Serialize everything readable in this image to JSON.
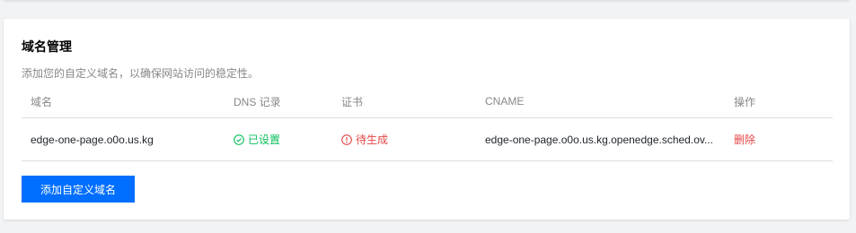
{
  "domain_management": {
    "title": "域名管理",
    "description": "添加您的自定义域名，以确保网站访问的稳定性。",
    "columns": {
      "domain": "域名",
      "dns": "DNS 记录",
      "certificate": "证书",
      "cname": "CNAME",
      "actions": "操作"
    },
    "rows": [
      {
        "domain": "edge-one-page.o0o.us.kg",
        "dns_status": "已设置",
        "dns_status_icon": "check-circle-icon",
        "certificate_status": "待生成",
        "certificate_status_icon": "alert-circle-icon",
        "cname": "edge-one-page.o0o.us.kg.openedge.sched.ov...",
        "action": "删除"
      }
    ],
    "add_button_label": "添加自定义域名"
  },
  "colors": {
    "primary": "#006eff",
    "success": "#0abf5b",
    "danger": "#e54545",
    "muted_text": "#888888"
  }
}
